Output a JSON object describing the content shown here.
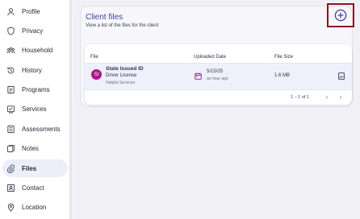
{
  "sidebar": {
    "items": [
      {
        "label": "Profile",
        "icon": "person-icon"
      },
      {
        "label": "Privacy",
        "icon": "shield-icon"
      },
      {
        "label": "Household",
        "icon": "people-icon"
      },
      {
        "label": "History",
        "icon": "history-icon"
      },
      {
        "label": "Programs",
        "icon": "programs-icon"
      },
      {
        "label": "Services",
        "icon": "services-icon"
      },
      {
        "label": "Assessments",
        "icon": "assessment-icon"
      },
      {
        "label": "Notes",
        "icon": "notes-icon"
      },
      {
        "label": "Files",
        "icon": "paperclip-icon",
        "active": true
      },
      {
        "label": "Contact",
        "icon": "contact-icon"
      },
      {
        "label": "Location",
        "icon": "location-icon"
      }
    ]
  },
  "main": {
    "title": "Client files",
    "subtitle": "View a list of the files for the client",
    "add_icon": "add-circle-icon",
    "table": {
      "columns": [
        "File",
        "Uploaded Date",
        "File Size"
      ],
      "rows": [
        {
          "avatar": "SI",
          "name": "State Issued ID",
          "type": "Driver License",
          "owner": "Helpful Services",
          "date": "5/15/25",
          "relative_time": "an hour ago",
          "size": "1.6 MB"
        }
      ],
      "pagination": {
        "range": "1 – 1 of 1"
      }
    }
  },
  "colors": {
    "accent": "#3b42a8",
    "avatar": "#b0158f",
    "highlight_border": "#8a1423",
    "active_nav": "#eceffa"
  }
}
